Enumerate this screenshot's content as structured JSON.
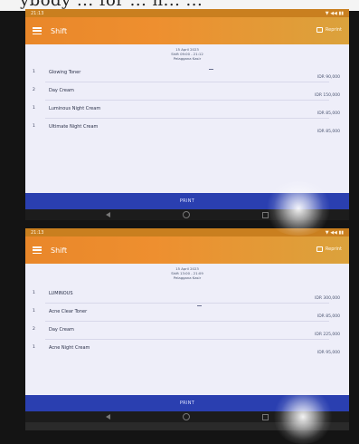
{
  "caption": "ybody ... for ... n... ...",
  "screens": [
    {
      "status": {
        "time": "21:13",
        "icons": "▼ ◀◀ ▮▮"
      },
      "appbar": {
        "title": "Shift",
        "action": "Reprint"
      },
      "info": {
        "date": "15 April 2023",
        "shift": "Shift 09:00 - 21:12",
        "store": "Pelaggana Kasir"
      },
      "items": [
        {
          "qty": "1",
          "name": "Glowing Toner",
          "price": "IDR 90,000"
        },
        {
          "qty": "2",
          "name": "Day Cream",
          "price": "IDR 150,000"
        },
        {
          "qty": "1",
          "name": "Luminous Night Cream",
          "price": "IDR 85,000"
        },
        {
          "qty": "1",
          "name": "Ultimate Night Cream",
          "price": "IDR 85,000"
        }
      ],
      "print": "PRINT"
    },
    {
      "status": {
        "time": "21:13",
        "icons": "▼ ◀◀ ▮▮"
      },
      "appbar": {
        "title": "Shift",
        "action": "Reprint"
      },
      "info": {
        "date": "15 April 2023",
        "shift": "Shift 13:00 - 21:09",
        "store": "Pelaggana Kasir"
      },
      "items": [
        {
          "qty": "1",
          "name": "LUMINOUS",
          "price": "IDR 300,000"
        },
        {
          "qty": "1",
          "name": "Acne Clear Toner",
          "price": "IDR 85,000"
        },
        {
          "qty": "2",
          "name": "Day Cream",
          "price": "IDR 225,000"
        },
        {
          "qty": "1",
          "name": "Acne Night Cream",
          "price": "IDR 95,000"
        }
      ],
      "print": "PRINT"
    }
  ]
}
